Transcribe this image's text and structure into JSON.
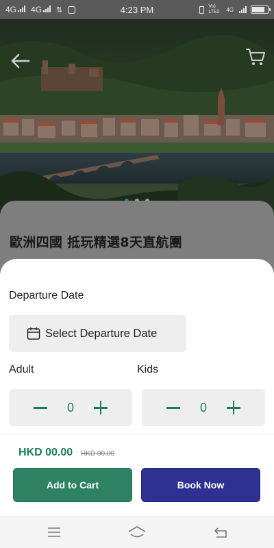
{
  "status_bar": {
    "network_1": "4G",
    "network_2": "4G",
    "time": "4:23 PM",
    "volte": "Vo) LTE2",
    "network_3": "4G",
    "battery_level": 0.85
  },
  "hero": {
    "slide_count": 3,
    "active_slide": 1
  },
  "tour": {
    "title": "歐洲四國 抵玩精選8天直航團"
  },
  "booking": {
    "departure_label": "Departure Date",
    "date_button_label": "Select Departure Date",
    "adult_label": "Adult",
    "kids_label": "Kids",
    "adult_count": "0",
    "kids_count": "0",
    "price": "HKD 00.00",
    "original_price": "HKD 00.00",
    "add_to_cart_label": "Add to Cart",
    "book_now_label": "Book Now"
  },
  "colors": {
    "accent_green": "#2e8163",
    "accent_navy": "#2e3192",
    "price_green": "#1b7c5b"
  },
  "icons": {
    "back": "arrow-left-icon",
    "cart": "shopping-cart-icon",
    "calendar": "calendar-icon",
    "minus": "minus-icon",
    "plus": "plus-icon",
    "nav_menu": "menu-icon",
    "nav_home": "home-icon",
    "nav_back": "back-icon"
  }
}
